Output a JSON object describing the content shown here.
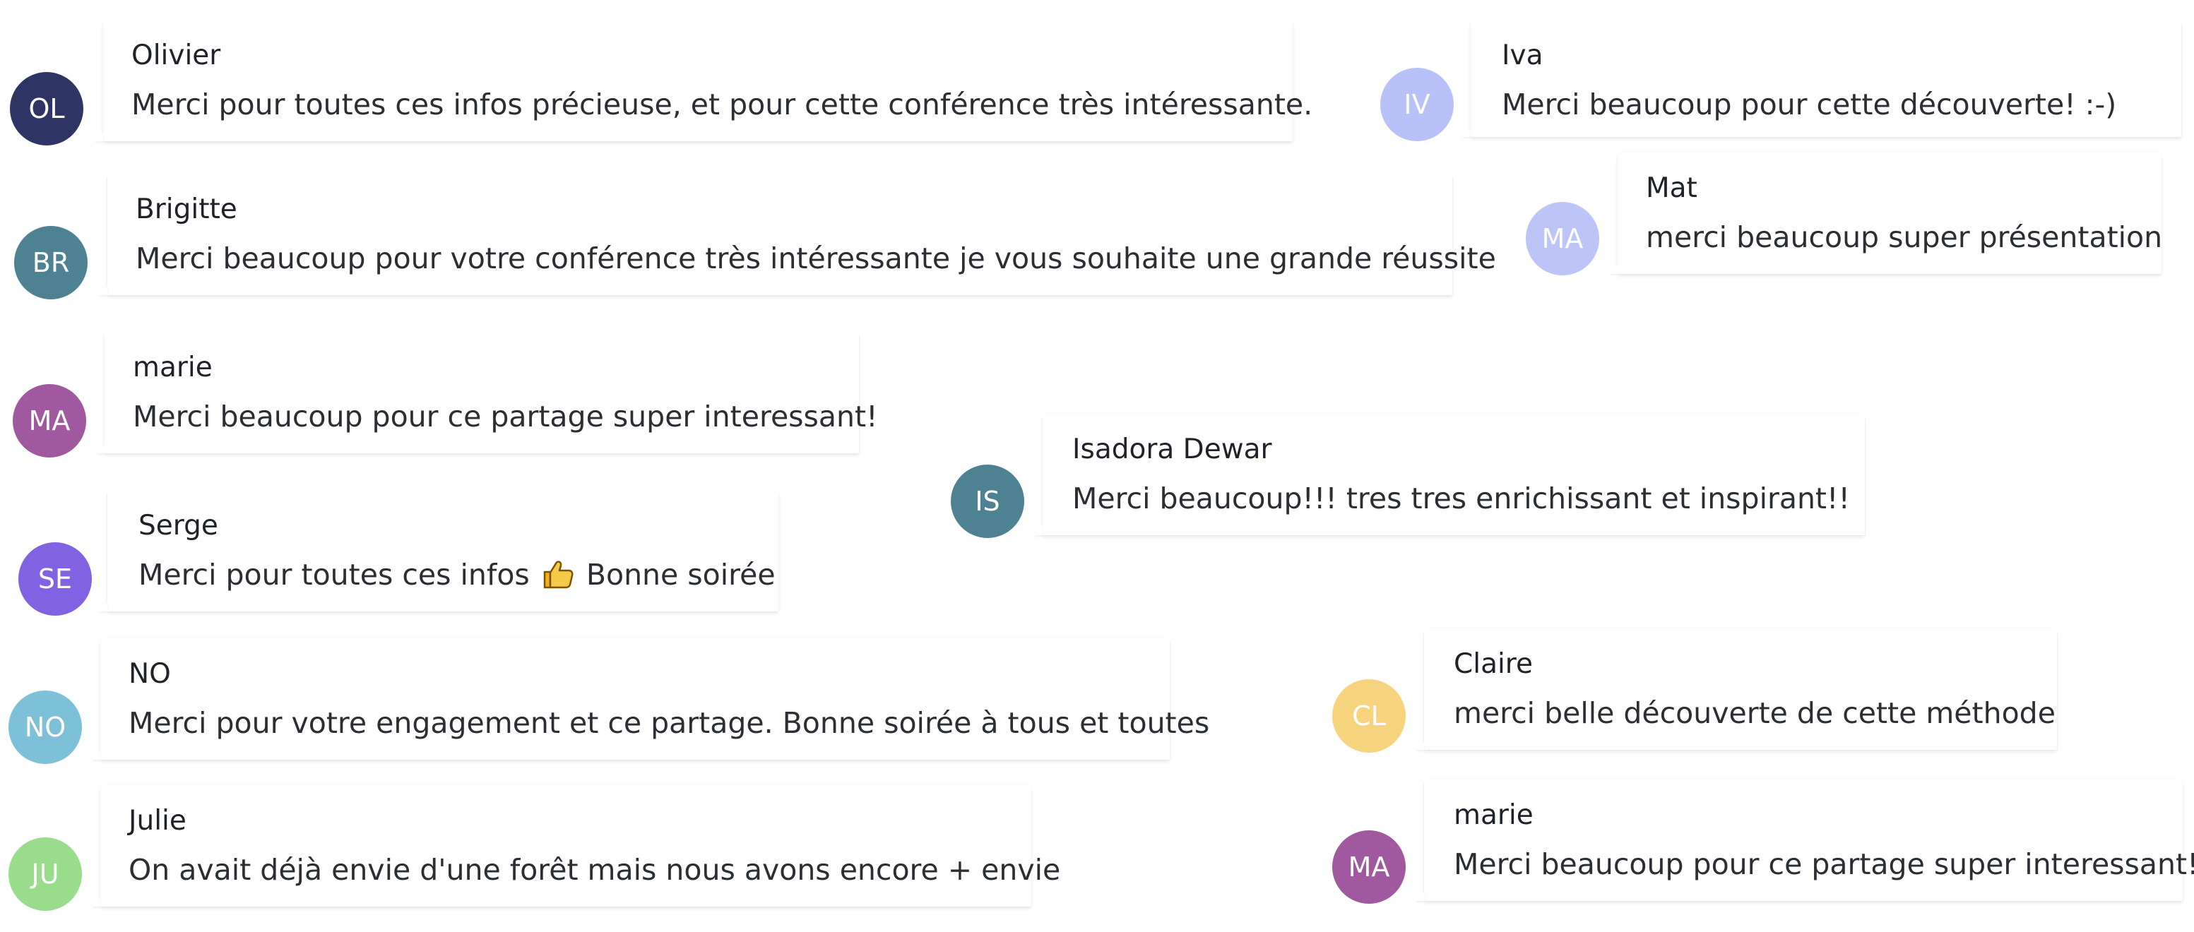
{
  "messages": [
    {
      "author": "Olivier",
      "initials": "OL",
      "avatar_color": "#2e3564",
      "text": "Merci pour toutes ces infos précieuse, et pour cette conférence très intéressante."
    },
    {
      "author": "Brigitte",
      "initials": "BR",
      "avatar_color": "#4e8192",
      "text": "Merci beaucoup pour votre conférence très intéressante je vous souhaite une grande réussite"
    },
    {
      "author": "marie",
      "initials": "MA",
      "avatar_color": "#a0599e",
      "text": "Merci beaucoup pour ce partage super interessant!"
    },
    {
      "author": "Serge",
      "initials": "SE",
      "avatar_color": "#8162e3",
      "text_before": "Merci pour toutes ces infos",
      "emoji": "thumbs-up",
      "text_after": "Bonne soirée"
    },
    {
      "author": "NO",
      "initials": "NO",
      "avatar_color": "#7ec0d8",
      "text": "Merci pour votre engagement et ce partage. Bonne soirée à tous et toutes"
    },
    {
      "author": "Julie",
      "initials": "JU",
      "avatar_color": "#98dc8c",
      "text": "On avait déjà envie d'une forêt mais nous avons encore + envie"
    },
    {
      "author": "Iva",
      "initials": "IV",
      "avatar_color": "#b8c2f8",
      "text": "Merci beaucoup pour cette découverte! :-)"
    },
    {
      "author": "Mat",
      "initials": "MA",
      "avatar_color": "#bcc4f8",
      "text": "merci beaucoup super présentation"
    },
    {
      "author": "Isadora Dewar",
      "initials": "IS",
      "avatar_color": "#4e8192",
      "text": "Merci beaucoup!!! tres tres enrichissant et inspirant!!"
    },
    {
      "author": "Claire",
      "initials": "CL",
      "avatar_color": "#f6d47e",
      "text": "merci belle découverte de cette méthode"
    },
    {
      "author": "marie",
      "initials": "MA",
      "avatar_color": "#a0599e",
      "text": "Merci beaucoup pour ce partage super interessant!"
    }
  ]
}
